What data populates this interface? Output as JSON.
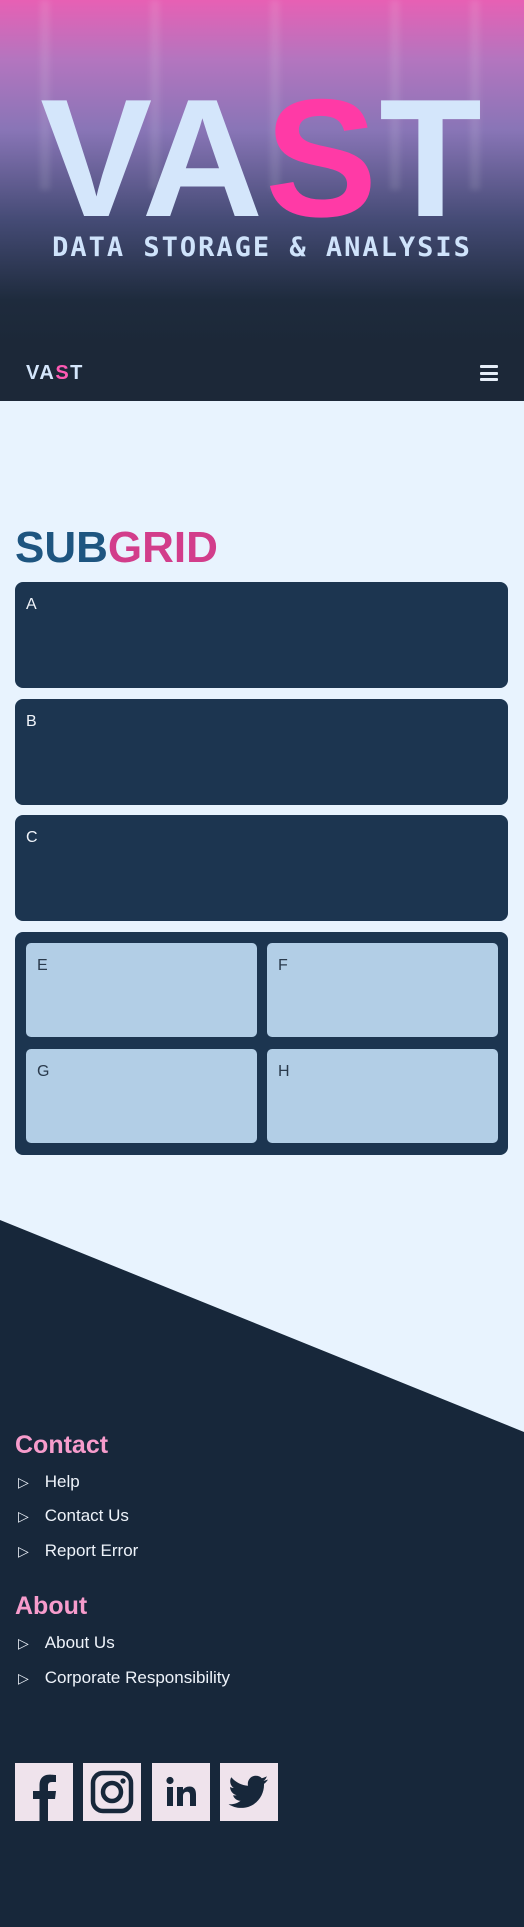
{
  "hero": {
    "title_part1": "VA",
    "title_accent": "S",
    "title_part2": "T",
    "subtitle": "DATA STORAGE & ANALYSIS"
  },
  "nav": {
    "logo_part1": "VA",
    "logo_accent": "S",
    "logo_part2": "T",
    "menu_icon": "hamburger-icon"
  },
  "section": {
    "title_part1": "SUB",
    "title_part2": "GRID",
    "cards": [
      "A",
      "B",
      "C"
    ],
    "subcards": [
      "E",
      "F",
      "G",
      "H"
    ]
  },
  "footer": {
    "contact_heading": "Contact",
    "contact_links": [
      "Help",
      "Contact Us",
      "Report Error"
    ],
    "about_heading": "About",
    "about_links": [
      "About Us",
      "Corporate Responsibility"
    ],
    "social": [
      "facebook-icon",
      "instagram-icon",
      "linkedin-icon",
      "twitter-icon"
    ]
  },
  "colors": {
    "accent_pink": "#ff3aa6",
    "navy": "#1c3550",
    "light_blue": "#b2cee6",
    "background": "#e8f3fe",
    "footer": "#17273a",
    "footer_heading": "#f79ccc"
  }
}
